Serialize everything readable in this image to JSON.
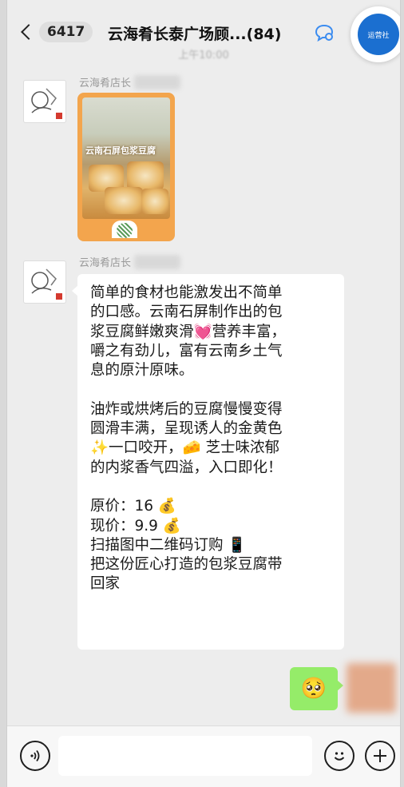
{
  "header": {
    "back_count": "6417",
    "title": "云海肴长泰广场顾...(84)",
    "timestamp": "上午10:00",
    "pip_label": "运营社"
  },
  "messages": [
    {
      "sender": "云海肴店长",
      "type": "image",
      "image_caption": "云南石屏包浆豆腐"
    },
    {
      "sender": "云海肴店长",
      "type": "text",
      "text": "简单的食材也能激发出不简单\n的口感。云南石屏制作出的包\n浆豆腐鲜嫩爽滑💓营养丰富，\n嚼之有劲儿，富有云南乡土气\n息的原汁原味。\n\n油炸或烘烤后的豆腐慢慢变得\n圆滑丰满，呈现诱人的金黄色\n✨一口咬开，🧀 芝士味浓郁\n的内浆香气四溢，入口即化！\n\n原价：16 💰\n现价：9.9 💰\n扫描图中二维码订购 📱\n把这份匠心打造的包浆豆腐带\n回家"
    }
  ],
  "my_message": {
    "emoji": "🥺"
  },
  "input_bar": {
    "voice_icon": "voice-icon",
    "emoji_icon": "smiley-icon",
    "plus_icon": "plus-icon"
  }
}
